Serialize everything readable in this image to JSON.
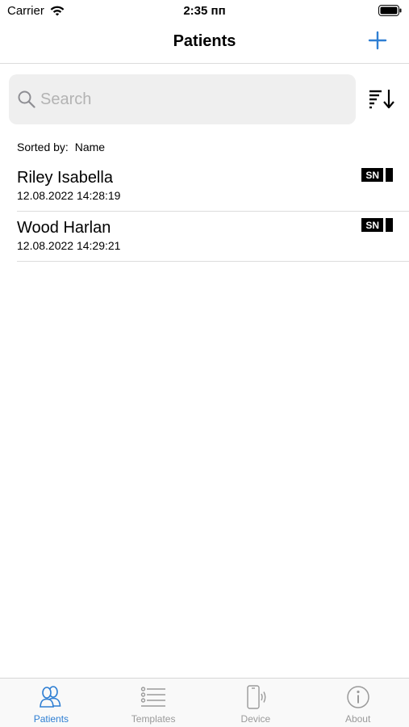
{
  "status_bar": {
    "carrier": "Carrier",
    "time": "2:35 пп"
  },
  "nav": {
    "title": "Patients"
  },
  "search": {
    "placeholder": "Search",
    "value": ""
  },
  "sorted_by": {
    "label": "Sorted by:",
    "value": "Name"
  },
  "patients": [
    {
      "name": "Riley Isabella",
      "date": "12.08.2022 14:28:19",
      "badge": "SN"
    },
    {
      "name": "Wood Harlan",
      "date": "12.08.2022 14:29:21",
      "badge": "SN"
    }
  ],
  "tabs": [
    {
      "label": "Patients",
      "icon": "patients-icon",
      "active": true
    },
    {
      "label": "Templates",
      "icon": "list-icon",
      "active": false
    },
    {
      "label": "Device",
      "icon": "device-icon",
      "active": false
    },
    {
      "label": "About",
      "icon": "info-icon",
      "active": false
    }
  ],
  "colors": {
    "accent": "#2f7fd3",
    "inactive": "#9a9a9a"
  }
}
